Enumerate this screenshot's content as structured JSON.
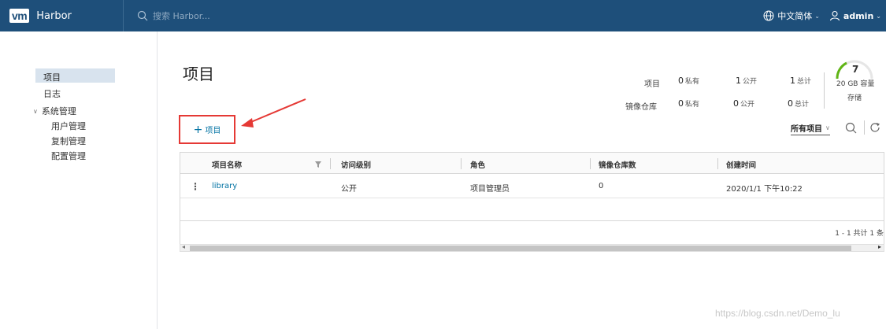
{
  "header": {
    "logo": "vm",
    "app_name": "Harbor",
    "search_placeholder": "搜索 Harbor...",
    "language": "中文简体",
    "user": "admin"
  },
  "sidebar": {
    "items": [
      {
        "label": "项目",
        "active": true
      },
      {
        "label": "日志"
      },
      {
        "label": "系统管理",
        "expanded": true
      },
      {
        "label": "用户管理"
      },
      {
        "label": "复制管理"
      },
      {
        "label": "配置管理"
      }
    ]
  },
  "main": {
    "title": "项目",
    "stats": {
      "row1_label": "项目",
      "row2_label": "镜像仓库",
      "project_private": "0",
      "project_public": "1",
      "project_total": "1",
      "repo_private": "0",
      "repo_public": "0",
      "repo_total": "0",
      "private_label": "私有",
      "public_label": "公开",
      "total_label": "总计"
    },
    "storage": {
      "count": "7",
      "capacity": "20 GB 容量",
      "label": "存储"
    },
    "add_button": "项目",
    "filter": "所有项目",
    "table": {
      "headers": [
        "项目名称",
        "访问级别",
        "角色",
        "镜像仓库数",
        "创建时间"
      ],
      "rows": [
        {
          "name": "library",
          "access": "公开",
          "role": "项目管理员",
          "repos": "0",
          "created": "2020/1/1 下午10:22"
        }
      ],
      "pagination": "1 - 1 共计 1 条"
    }
  },
  "watermark": "https://blog.csdn.net/Demo_lu",
  "colors": {
    "header_bg": "#1e4f7a",
    "link": "#0072a3",
    "highlight": "#e53935",
    "gauge": "#60b515"
  }
}
